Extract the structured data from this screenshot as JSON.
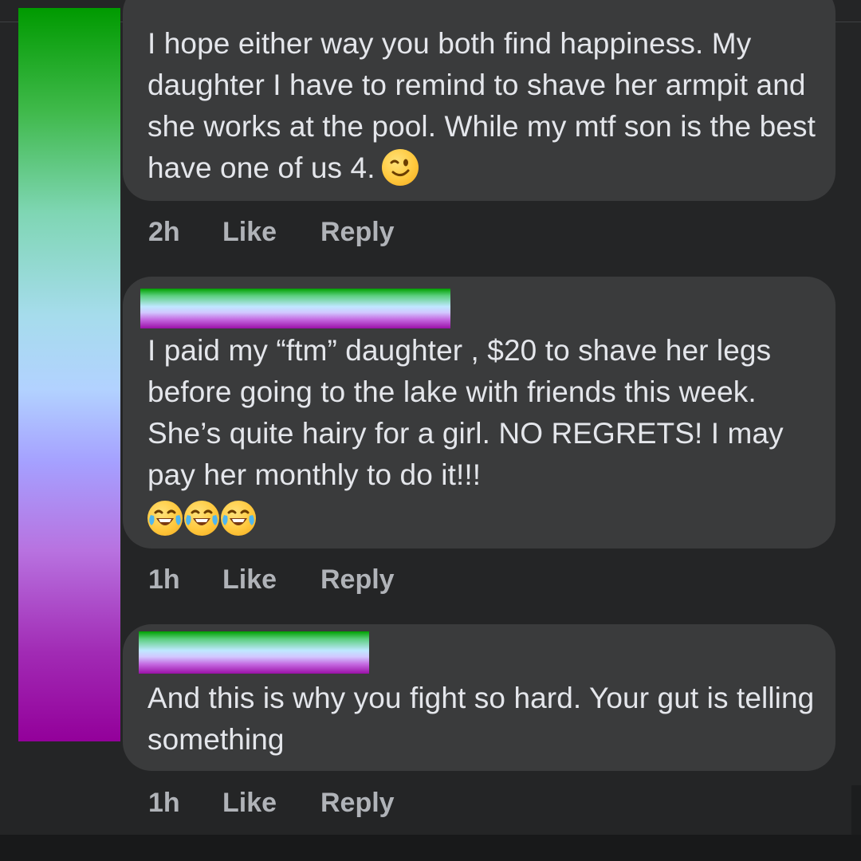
{
  "comments": [
    {
      "text": "I hope either way you both find happiness. My daughter I have to remind to shave her armpit and she works at the pool. While my mtf son is the best have one of us 4.",
      "emoji": "winking-face",
      "time": "2h",
      "like_label": "Like",
      "reply_label": "Reply"
    },
    {
      "text": "I paid my “ftm” daughter , $20 to shave her legs before going to the lake with friends this week. She’s quite hairy for a girl.  NO REGRETS!  I may pay her monthly to do it!!!",
      "emoji": "face-with-tears-of-joy x3",
      "time": "1h",
      "like_label": "Like",
      "reply_label": "Reply"
    },
    {
      "text": "And this is why you fight so hard. Your gut is telling something",
      "time": "1h",
      "like_label": "Like",
      "reply_label": "Reply"
    }
  ],
  "colors": {
    "background": "#242526",
    "bubble": "#3a3b3c",
    "text": "#e4e6eb",
    "meta": "#b0b3b8"
  }
}
